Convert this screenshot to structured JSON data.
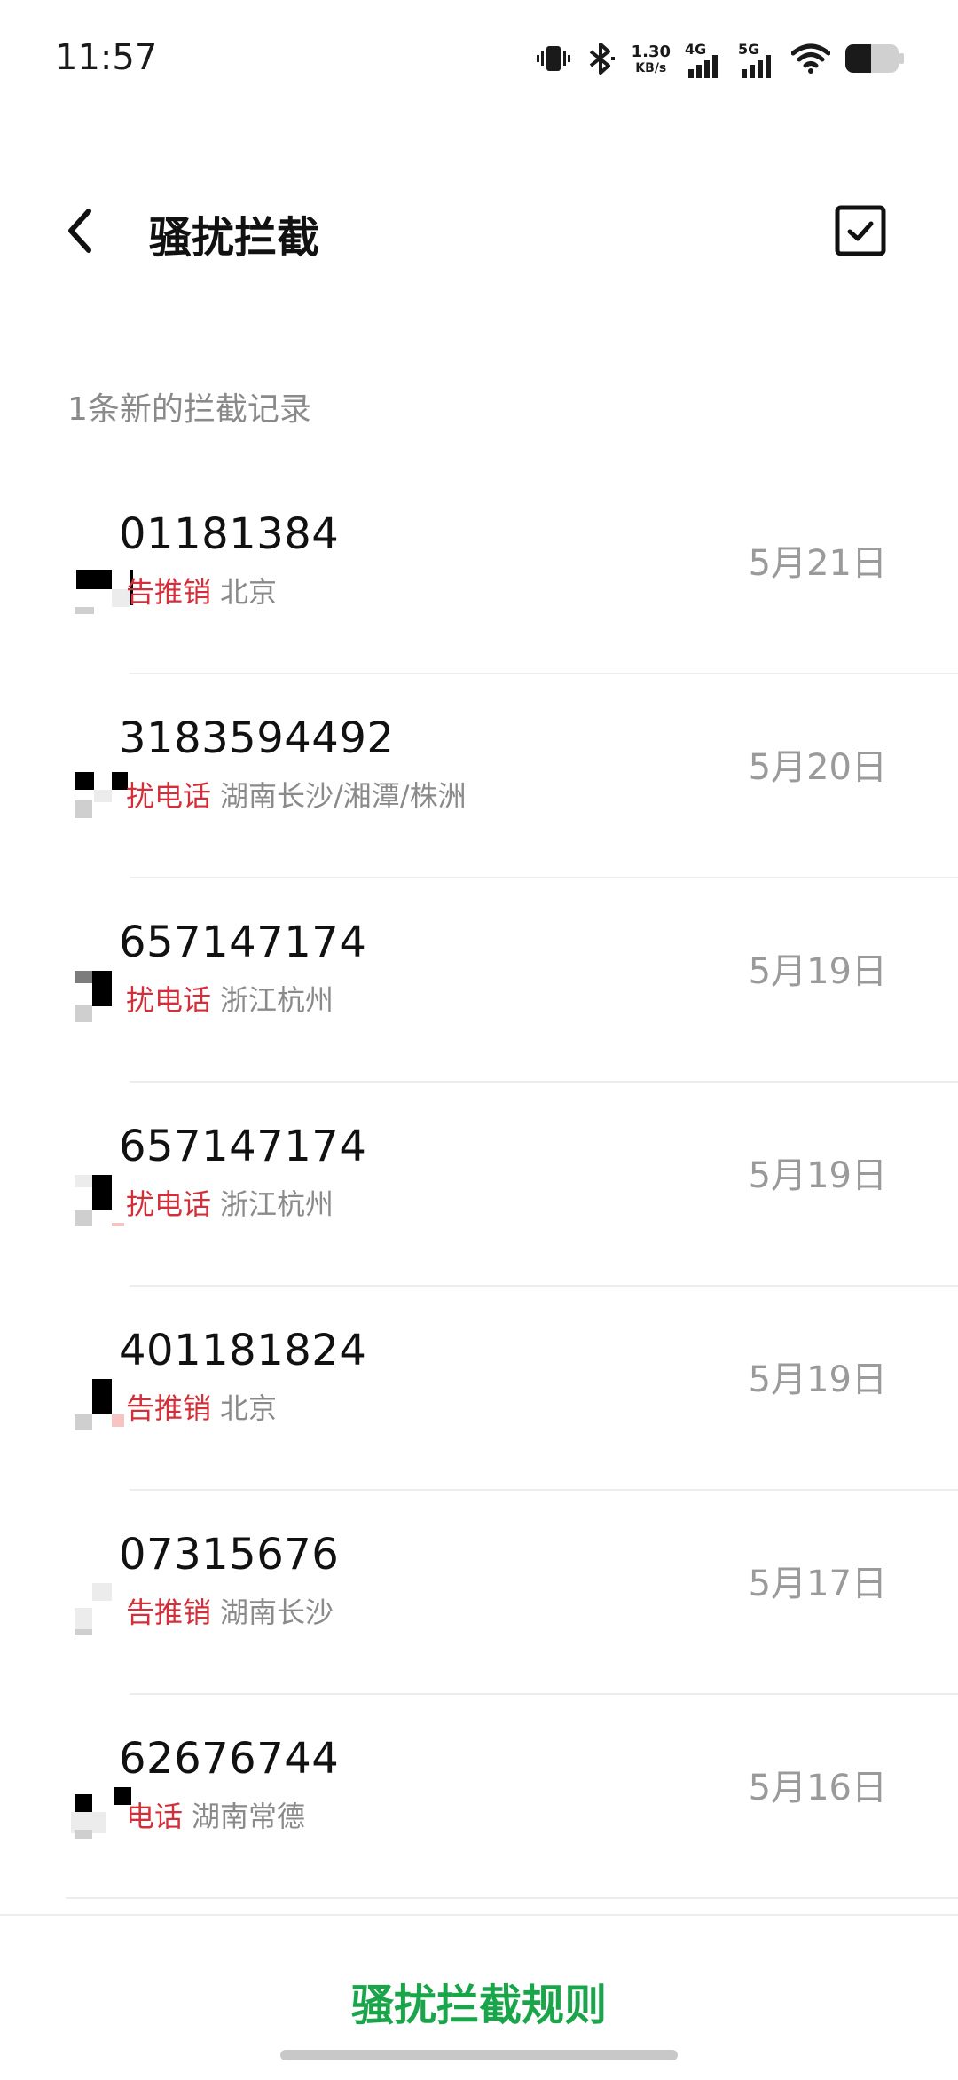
{
  "status_bar": {
    "time": "11:57",
    "net_speed_value": "1.30",
    "net_speed_unit": "KB/s",
    "sig1_tag": "4G",
    "sig2_tag": "5G"
  },
  "header": {
    "title": "骚扰拦截"
  },
  "section": {
    "label": "1条新的拦截记录"
  },
  "records": [
    {
      "number": "01181384",
      "tag": "告推销",
      "location": "北京",
      "date": "5月21日"
    },
    {
      "number": "3183594492",
      "tag": "扰电话",
      "location": "湖南长沙/湘潭/株洲",
      "date": "5月20日"
    },
    {
      "number": "657147174",
      "tag": "扰电话",
      "location": "浙江杭州",
      "date": "5月19日"
    },
    {
      "number": "657147174",
      "tag": "扰电话",
      "location": "浙江杭州",
      "date": "5月19日"
    },
    {
      "number": "401181824",
      "tag": "告推销",
      "location": "北京",
      "date": "5月19日"
    },
    {
      "number": "07315676",
      "tag": "告推销",
      "location": "湖南长沙",
      "date": "5月17日"
    },
    {
      "number": "62676744",
      "tag": "电话",
      "location": "湖南常德",
      "date": "5月16日"
    }
  ],
  "footer": {
    "rules_label": "骚扰拦截规则"
  },
  "colors": {
    "accent_green": "#1aa54b",
    "tag_red": "#d32f3a",
    "secondary_gray": "#8a8a8a"
  }
}
